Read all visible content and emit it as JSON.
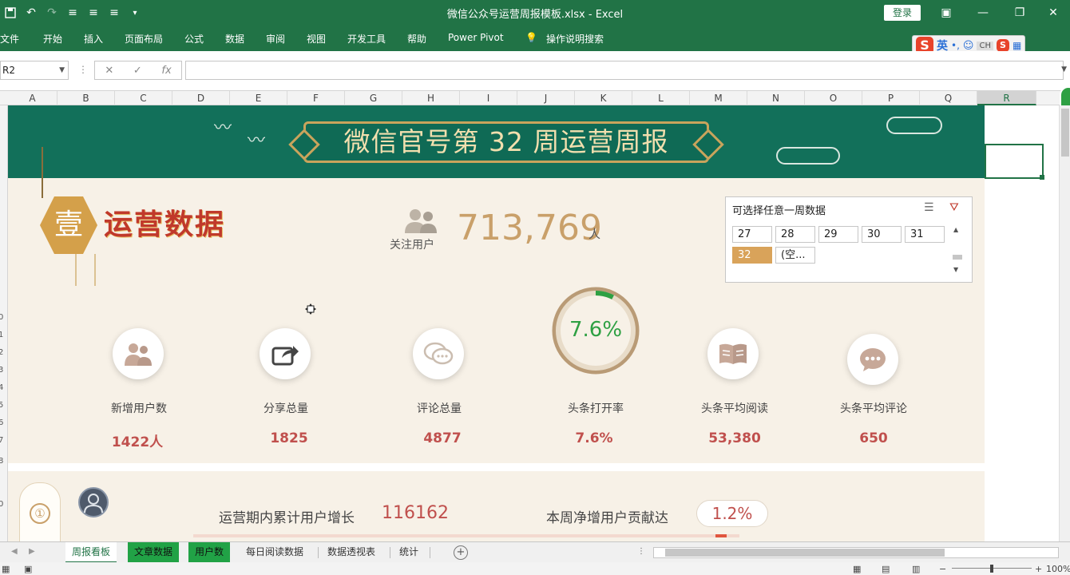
{
  "titlebar": {
    "doc_title": "微信公众号运营周报模板.xlsx  -  Excel",
    "login_label": "登录"
  },
  "ribbon": {
    "tabs": [
      "文件",
      "开始",
      "插入",
      "页面布局",
      "公式",
      "数据",
      "审阅",
      "视图",
      "开发工具",
      "帮助",
      "Power Pivot",
      "操作说明搜索"
    ],
    "ime_label": "英",
    "ime_ch": "CH"
  },
  "formula_bar": {
    "namebox_value": "R2",
    "formula_value": ""
  },
  "columns": [
    "A",
    "B",
    "C",
    "D",
    "E",
    "F",
    "G",
    "H",
    "I",
    "J",
    "K",
    "L",
    "M",
    "N",
    "O",
    "P",
    "Q",
    "R"
  ],
  "selected_column": "R",
  "banner": {
    "title": "微信官号第 32 周运营周报"
  },
  "section1": {
    "badge": "壹",
    "title": "运营数据",
    "follow_label": "关注用户",
    "follow_value": "713,769",
    "follow_unit": "人"
  },
  "slicer": {
    "title": "可选择任意一周数据",
    "items": [
      "27",
      "28",
      "29",
      "30",
      "31",
      "32",
      "(空..."
    ],
    "selected": "32"
  },
  "kpis": [
    {
      "label": "新增用户数",
      "value": "1422人",
      "icon": "users-icon"
    },
    {
      "label": "分享总量",
      "value": "1825",
      "icon": "share-icon"
    },
    {
      "label": "评论总量",
      "value": "4877",
      "icon": "comment-icon"
    },
    {
      "label": "头条打开率",
      "value": "7.6%",
      "icon": "ring-progress"
    },
    {
      "label": "头条平均阅读",
      "value": "53,380",
      "icon": "book-icon"
    },
    {
      "label": "头条平均评论",
      "value": "650",
      "icon": "chat-bubble-icon"
    }
  ],
  "open_rate": {
    "text": "7.6%",
    "fraction": 0.076
  },
  "section2": {
    "badge_num": "①",
    "growth_label": "运营期内累计用户增长",
    "growth_value": "116162",
    "contrib_label": "本周净增用户贡献达",
    "contrib_value": "1.2%",
    "contrib_fraction": 0.012
  },
  "sheets": [
    {
      "name": "周报看板",
      "state": "active"
    },
    {
      "name": "文章数据",
      "state": "green"
    },
    {
      "name": "用户数",
      "state": "green"
    },
    {
      "name": "每日阅读数据",
      "state": "normal"
    },
    {
      "name": "数据透视表",
      "state": "normal"
    },
    {
      "name": "统计",
      "state": "normal"
    }
  ],
  "status": {
    "zoom": "100%"
  },
  "colors": {
    "excel_green": "#217346",
    "banner_green": "#12705a",
    "gold": "#c9a45c",
    "accent_red": "#c0504d"
  }
}
